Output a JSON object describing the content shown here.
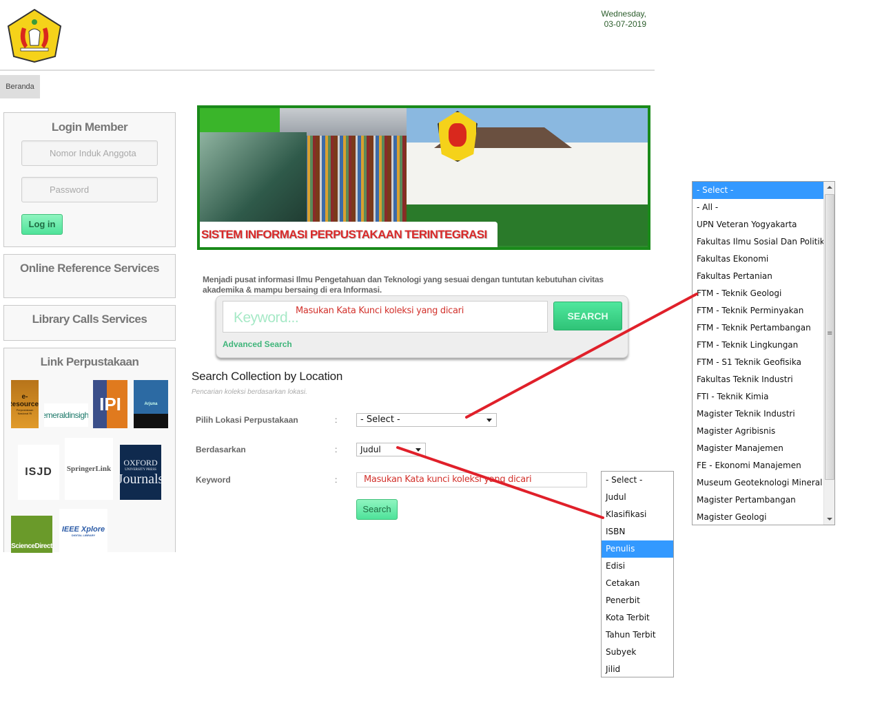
{
  "header": {
    "logo_alt": "UPN Veteran Yogyakarta crest",
    "date_day": "Wednesday,",
    "date_value": "03-07-2019"
  },
  "nav": {
    "items": [
      {
        "label": "Beranda"
      }
    ]
  },
  "sidebar": {
    "login": {
      "title": "Login Member",
      "username_placeholder": "Nomor Induk Anggota",
      "password_placeholder": "Password",
      "login_button": "Log in"
    },
    "online_reference": {
      "title": "Online Reference Services"
    },
    "library_calls": {
      "title": "Library Calls Services"
    },
    "links": {
      "title": "Link Perpustakaan",
      "items": [
        {
          "label": "e-Resources",
          "sub": "Perpustakaan Nasional RI"
        },
        {
          "label": "emeraldinsight"
        },
        {
          "label": "IPI"
        },
        {
          "label": "Arjuna"
        },
        {
          "label": "ISJD"
        },
        {
          "label": "SpringerLink"
        },
        {
          "label": "OXFORD",
          "sub": "UNIVERSITY PRESS",
          "extra": "Journals"
        },
        {
          "label": "ScienceDirect"
        },
        {
          "label": "IEEE Xplore",
          "sub": "DIGITAL LIBRARY"
        }
      ]
    }
  },
  "banner": {
    "title": "SISTEM INFORMASI PERPUSTAKAAN TERINTEGRASI"
  },
  "mission": "Menjadi pusat informasi Ilmu Pengetahuan dan Teknologi yang sesuai dengan tuntutan kebutuhan civitas akademika & mampu bersaing di era Informasi.",
  "quick_search": {
    "placeholder": "Keyword...",
    "annotation": "Masukan Kata Kunci koleksi yang dicari",
    "button": "SEARCH",
    "advanced_link": "Advanced Search"
  },
  "collection_search": {
    "title": "Search Collection by Location",
    "subtitle": "Pencarian koleksi berdasarkan lokasi.",
    "location_label": "Pilih Lokasi Perpustakaan",
    "location_value": "- Select -",
    "by_label": "Berdasarkan",
    "by_value": "Judul",
    "keyword_label": "Keyword",
    "keyword_value": "Masukan Kata kunci koleksi yang dicari",
    "colon": ":",
    "search_button": "Search"
  },
  "by_dropdown": {
    "selected": "Penulis",
    "options": [
      "- Select -",
      "Judul",
      "Klasifikasi",
      "ISBN",
      "Penulis",
      "Edisi",
      "Cetakan",
      "Penerbit",
      "Kota Terbit",
      "Tahun Terbit",
      "Subyek",
      "Jilid"
    ]
  },
  "location_dropdown": {
    "selected": "- Select -",
    "options": [
      "- Select -",
      "- All -",
      "UPN Veteran Yogyakarta",
      "Fakultas Ilmu Sosial Dan Politik",
      "Fakultas Ekonomi",
      "Fakultas Pertanian",
      "FTM - Teknik Geologi",
      "FTM - Teknik Perminyakan",
      "FTM - Teknik Pertambangan",
      "FTM - Teknik Lingkungan",
      "FTM - S1 Teknik Geofisika",
      "Fakultas Teknik Industri",
      "FTI - Teknik Kimia",
      "Magister Teknik Industri",
      "Magister Agribisnis",
      "Magister Manajemen",
      "FE - Ekonomi Manajemen",
      "Museum Geoteknologi Mineral",
      "Magister Pertambangan",
      "Magister Geologi"
    ]
  },
  "colors": {
    "accent_green": "#3fc07a",
    "banner_border": "#1a8a1a",
    "annotation_red": "#e0202a",
    "selection_blue": "#3399ff",
    "date_text": "#2b5d2b"
  }
}
